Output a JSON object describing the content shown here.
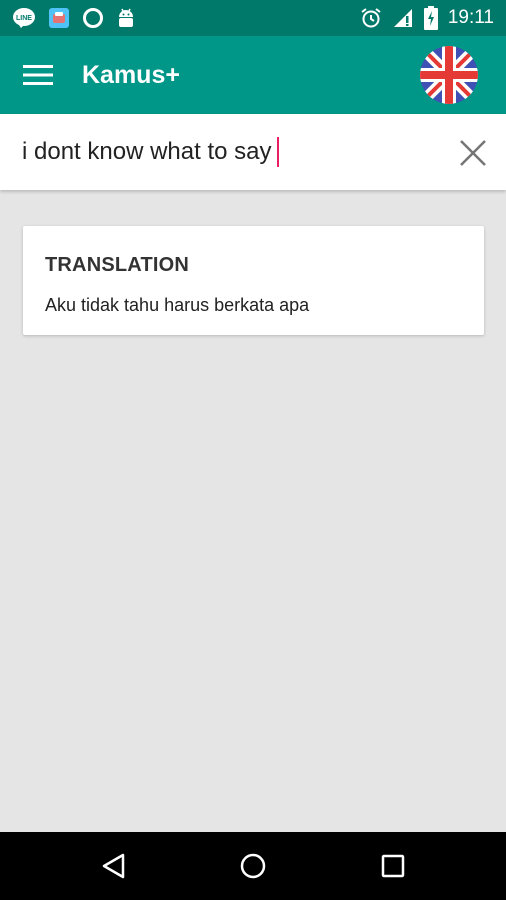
{
  "status_bar": {
    "time": "19:11",
    "left_icons": [
      "line-icon",
      "app-icon",
      "circle-icon",
      "android-icon"
    ],
    "right_icons": [
      "alarm-icon",
      "signal-icon",
      "battery-icon"
    ],
    "color": "#00796b"
  },
  "app_bar": {
    "title": "Kamus+",
    "menu_icon": "hamburger-menu-icon",
    "language_icon": "uk-flag-icon",
    "color": "#009688"
  },
  "search": {
    "value": "i dont know what to say",
    "clear_icon": "close-icon",
    "caret_color": "#e91e63"
  },
  "result_card": {
    "heading": "TRANSLATION",
    "text": "Aku tidak tahu harus berkata apa"
  },
  "nav_bar": {
    "icons": [
      "back-icon",
      "home-icon",
      "recent-apps-icon"
    ]
  }
}
